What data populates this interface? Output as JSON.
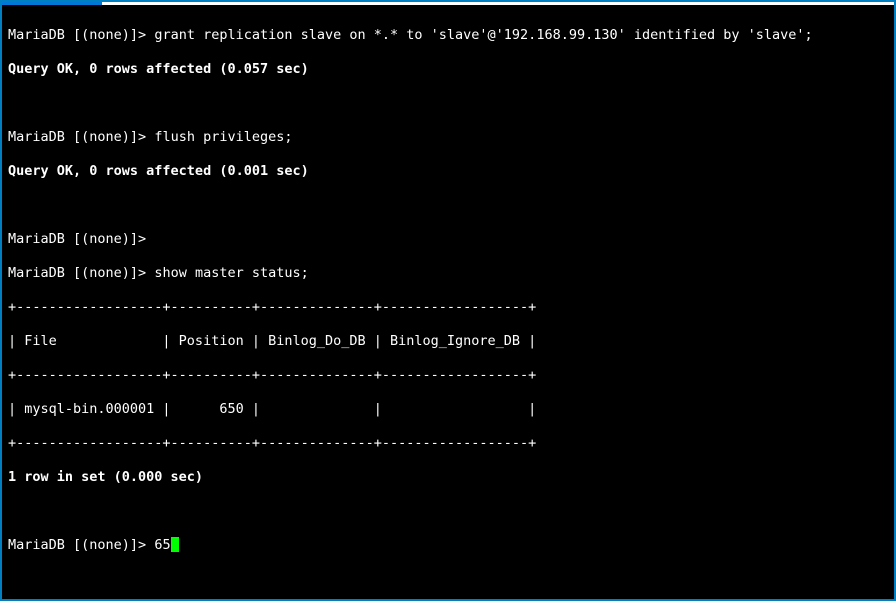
{
  "titlebar": {
    "active": true
  },
  "session": {
    "prompt": "MariaDB [(none)]> ",
    "cmd1": "grant replication slave on *.* to 'slave'@'192.168.99.130' identified by 'slave';",
    "resp1": "Query OK, 0 rows affected (0.057 sec)",
    "cmd2": "flush privileges;",
    "resp2": "Query OK, 0 rows affected (0.001 sec)",
    "cmd3_empty": "",
    "cmd4": "show master status;",
    "table": {
      "border_top": "+------------------+----------+--------------+------------------+",
      "header_row": "| File             | Position | Binlog_Do_DB | Binlog_Ignore_DB |",
      "border_mid": "+------------------+----------+--------------+------------------+",
      "data_row": "| mysql-bin.000001 |      650 |              |                  |",
      "border_bot": "+------------------+----------+--------------+------------------+",
      "columns": [
        "File",
        "Position",
        "Binlog_Do_DB",
        "Binlog_Ignore_DB"
      ],
      "rows": [
        {
          "File": "mysql-bin.000001",
          "Position": 650,
          "Binlog_Do_DB": "",
          "Binlog_Ignore_DB": ""
        }
      ]
    },
    "rows_msg": "1 row in set (0.000 sec)",
    "current_input": "65"
  }
}
